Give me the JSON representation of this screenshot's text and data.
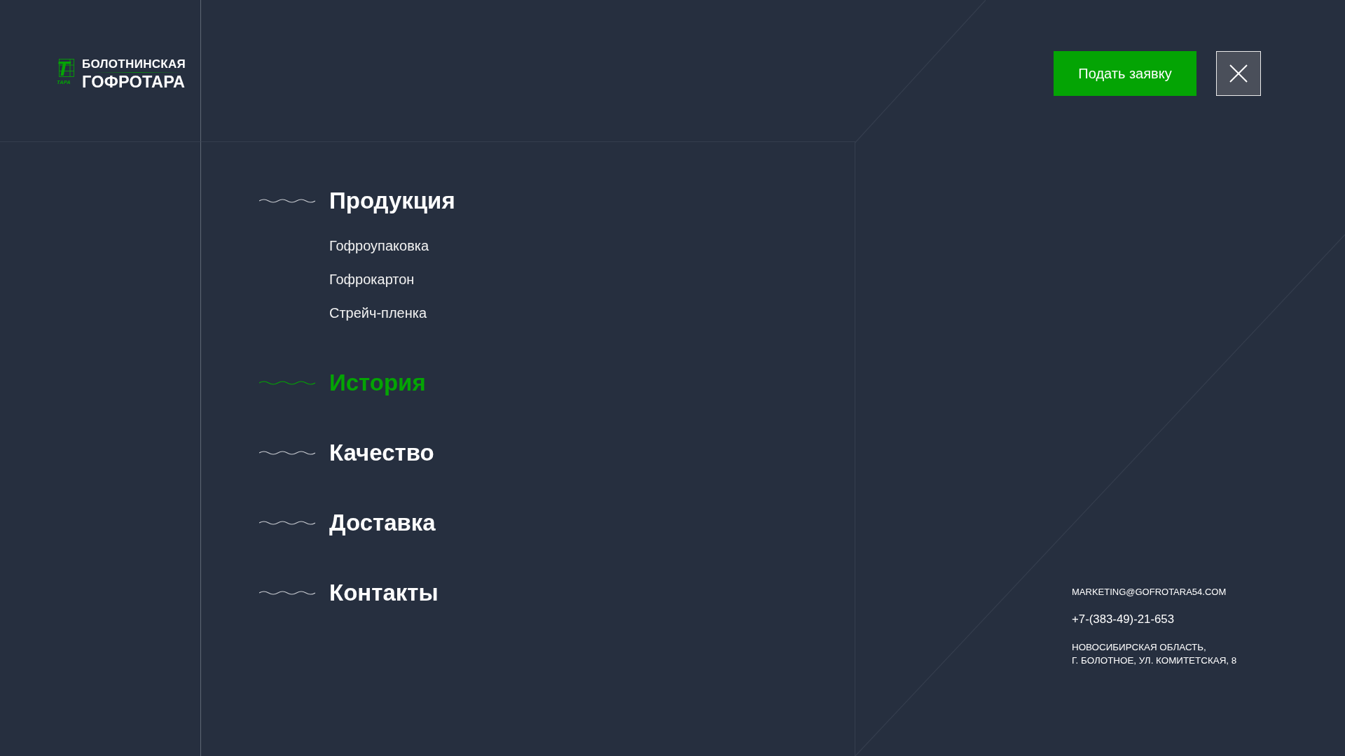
{
  "logo": {
    "mark_letter": "Т",
    "mark_caption": "ТАРА",
    "line_1": "БОЛОТНИНСКАЯ",
    "line_2": "ГОФРОТАРА"
  },
  "header_actions": {
    "apply_button": "Подать заявку"
  },
  "menu": [
    {
      "label": "Продукция",
      "selected": false,
      "children": [
        {
          "label": "Гофроупаковка",
          "selected": false
        },
        {
          "label": "Гофрокартон",
          "selected": false
        },
        {
          "label": "Стрейч-пленка",
          "selected": false
        }
      ]
    },
    {
      "label": "История",
      "selected": true
    },
    {
      "label": "Качество",
      "selected": false
    },
    {
      "label": "Доставка",
      "selected": false
    },
    {
      "label": "Контакты",
      "selected": false
    }
  ],
  "contacts": {
    "email": "MARKETING@GOFROTARA54.COM",
    "phone": "+7-(383-49)-21-653",
    "address": [
      "НОВОСИБИРСКАЯ ОБЛАСТЬ,",
      "Г. БОЛОТНОЕ, УЛ. КОМИТЕТСКАЯ, 8"
    ]
  }
}
